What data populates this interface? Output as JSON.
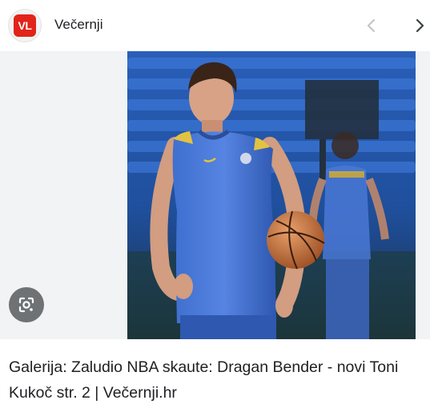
{
  "source": {
    "logo_text": "VL",
    "name": "Večernji",
    "brand_color": "#e2231a"
  },
  "navigation": {
    "prev_icon": "chevron-left-icon",
    "next_icon": "chevron-right-icon",
    "prev_disabled": true
  },
  "image": {
    "subject": "basketball player in blue and yellow jersey holding a basketball",
    "lens_icon": "google-lens-icon"
  },
  "caption": {
    "text": "Galerija: Zaludio NBA skaute: Dragan Bender - novi Toni Kukoč str. 2 | Večernji.hr"
  }
}
